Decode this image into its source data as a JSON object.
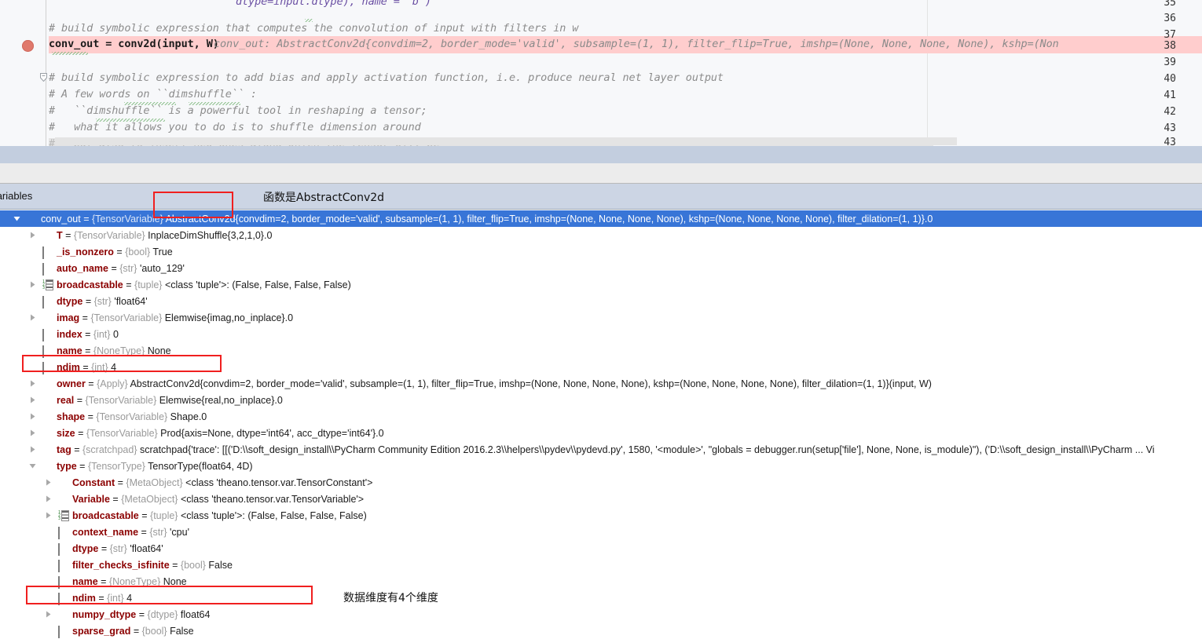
{
  "editor": {
    "line_numbers": [
      "35",
      "36",
      "37",
      "38",
      "39",
      "40",
      "41",
      "42",
      "43"
    ],
    "lines": [
      {
        "num": "35",
        "text": ""
      },
      {
        "num": "36",
        "text": "# build symbolic expression that computes the convolution of input with filters in w"
      },
      {
        "num": "37",
        "code": "conv_out = conv2d(input, W)",
        "hint": "conv_out: AbstractConv2d{convdim=2, border_mode='valid', subsample=(1, 1), filter_flip=True, imshp=(None, None, None, None), kshp=(Non"
      },
      {
        "num": "38",
        "text": ""
      },
      {
        "num": "39",
        "text": "# build symbolic expression to add bias and apply activation function, i.e. produce neural net layer output"
      },
      {
        "num": "40",
        "text": "# A few words on ``dimshuffle`` :"
      },
      {
        "num": "41",
        "text": "#   ``dimshuffle`` is a powerful tool in reshaping a tensor;"
      },
      {
        "num": "42",
        "text": "#   what it allows you to do is to shuffle dimension around"
      },
      {
        "num": "43",
        "text": "#   but also to insert new ones along which the tensor will be"
      }
    ],
    "breakpoint_line": "37",
    "error_line_bg": "#ffcdcd"
  },
  "panel": {
    "title": "Variables",
    "gear_label": "settings-gear",
    "annotation_top": "函数是AbstractConv2d",
    "annotation_bottom": "数据维度有4个维度",
    "selected_color": "#3875d7",
    "highlight_color": "#f01f1f"
  },
  "variables": [
    {
      "indent": 0,
      "arrow": "down",
      "icon": "object",
      "selected": true,
      "name": "conv_out",
      "eq": " = ",
      "type": "{TensorVariable}",
      "value": "AbstractConv2d{convdim=2, border_mode='valid', subsample=(1, 1), filter_flip=True, imshp=(None, None, None, None), kshp=(None, None, None, None), filter_dilation=(1, 1)}.0"
    },
    {
      "indent": 1,
      "arrow": "right",
      "icon": "object",
      "selected": false,
      "name": "T",
      "eq": " = ",
      "type": "{TensorVariable}",
      "value": "InplaceDimShuffle{3,2,1,0}.0"
    },
    {
      "indent": 1,
      "arrow": "none",
      "icon": "primitive",
      "selected": false,
      "name": "_is_nonzero",
      "eq": " = ",
      "type": "{bool}",
      "value": "True"
    },
    {
      "indent": 1,
      "arrow": "none",
      "icon": "primitive",
      "selected": false,
      "name": "auto_name",
      "eq": " = ",
      "type": "{str}",
      "value": "'auto_129'"
    },
    {
      "indent": 1,
      "arrow": "right",
      "icon": "list",
      "selected": false,
      "name": "broadcastable",
      "eq": " = ",
      "type": "{tuple}",
      "value": "<class 'tuple'>: (False, False, False, False)"
    },
    {
      "indent": 1,
      "arrow": "none",
      "icon": "primitive",
      "selected": false,
      "name": "dtype",
      "eq": " = ",
      "type": "{str}",
      "value": "'float64'"
    },
    {
      "indent": 1,
      "arrow": "right",
      "icon": "object",
      "selected": false,
      "name": "imag",
      "eq": " = ",
      "type": "{TensorVariable}",
      "value": "Elemwise{imag,no_inplace}.0"
    },
    {
      "indent": 1,
      "arrow": "none",
      "icon": "primitive",
      "selected": false,
      "name": "index",
      "eq": " = ",
      "type": "{int}",
      "value": "0"
    },
    {
      "indent": 1,
      "arrow": "none",
      "icon": "primitive",
      "selected": false,
      "name": "name",
      "eq": " = ",
      "type": "{NoneType}",
      "value": "None"
    },
    {
      "indent": 1,
      "arrow": "none",
      "icon": "primitive",
      "selected": false,
      "name": "ndim",
      "eq": " = ",
      "type": "{int}",
      "value": "4",
      "boxed": true
    },
    {
      "indent": 1,
      "arrow": "right",
      "icon": "object",
      "selected": false,
      "name": "owner",
      "eq": " = ",
      "type": "{Apply}",
      "value": "AbstractConv2d{convdim=2, border_mode='valid', subsample=(1, 1), filter_flip=True, imshp=(None, None, None, None), kshp=(None, None, None, None), filter_dilation=(1, 1)}(input, W)"
    },
    {
      "indent": 1,
      "arrow": "right",
      "icon": "object",
      "selected": false,
      "name": "real",
      "eq": " = ",
      "type": "{TensorVariable}",
      "value": "Elemwise{real,no_inplace}.0"
    },
    {
      "indent": 1,
      "arrow": "right",
      "icon": "object",
      "selected": false,
      "name": "shape",
      "eq": " = ",
      "type": "{TensorVariable}",
      "value": "Shape.0"
    },
    {
      "indent": 1,
      "arrow": "right",
      "icon": "object",
      "selected": false,
      "name": "size",
      "eq": " = ",
      "type": "{TensorVariable}",
      "value": "Prod{axis=None, dtype='int64', acc_dtype='int64'}.0"
    },
    {
      "indent": 1,
      "arrow": "right",
      "icon": "object",
      "selected": false,
      "name": "tag",
      "eq": " = ",
      "type": "{scratchpad}",
      "value": "scratchpad{'trace': [[('D:\\\\soft_design_install\\\\PyCharm Community Edition 2016.2.3\\\\helpers\\\\pydev\\\\pydevd.py', 1580, '<module>', \"globals = debugger.run(setup['file'], None, None, is_module)\"), ('D:\\\\soft_design_install\\\\PyCharm ... Vi"
    },
    {
      "indent": 1,
      "arrow": "down",
      "icon": "object",
      "selected": false,
      "name": "type",
      "eq": " = ",
      "type": "{TensorType}",
      "value": "TensorType(float64, 4D)"
    },
    {
      "indent": 2,
      "arrow": "right",
      "icon": "object",
      "selected": false,
      "name": "Constant",
      "eq": " = ",
      "type": "{MetaObject}",
      "value": "<class 'theano.tensor.var.TensorConstant'>"
    },
    {
      "indent": 2,
      "arrow": "right",
      "icon": "object",
      "selected": false,
      "name": "Variable",
      "eq": " = ",
      "type": "{MetaObject}",
      "value": "<class 'theano.tensor.var.TensorVariable'>"
    },
    {
      "indent": 2,
      "arrow": "right",
      "icon": "list",
      "selected": false,
      "name": "broadcastable",
      "eq": " = ",
      "type": "{tuple}",
      "value": "<class 'tuple'>: (False, False, False, False)"
    },
    {
      "indent": 2,
      "arrow": "none",
      "icon": "primitive",
      "selected": false,
      "name": "context_name",
      "eq": " = ",
      "type": "{str}",
      "value": "'cpu'"
    },
    {
      "indent": 2,
      "arrow": "none",
      "icon": "primitive",
      "selected": false,
      "name": "dtype",
      "eq": " = ",
      "type": "{str}",
      "value": "'float64'"
    },
    {
      "indent": 2,
      "arrow": "none",
      "icon": "primitive",
      "selected": false,
      "name": "filter_checks_isfinite",
      "eq": " = ",
      "type": "{bool}",
      "value": "False"
    },
    {
      "indent": 2,
      "arrow": "none",
      "icon": "primitive",
      "selected": false,
      "name": "name",
      "eq": " = ",
      "type": "{NoneType}",
      "value": "None"
    },
    {
      "indent": 2,
      "arrow": "none",
      "icon": "primitive",
      "selected": false,
      "name": "ndim",
      "eq": " = ",
      "type": "{int}",
      "value": "4",
      "boxed": true
    },
    {
      "indent": 2,
      "arrow": "right",
      "icon": "object",
      "selected": false,
      "name": "numpy_dtype",
      "eq": " = ",
      "type": "{dtype}",
      "value": "float64"
    },
    {
      "indent": 2,
      "arrow": "none",
      "icon": "primitive",
      "selected": false,
      "name": "sparse_grad",
      "eq": " = ",
      "type": "{bool}",
      "value": "False"
    }
  ]
}
